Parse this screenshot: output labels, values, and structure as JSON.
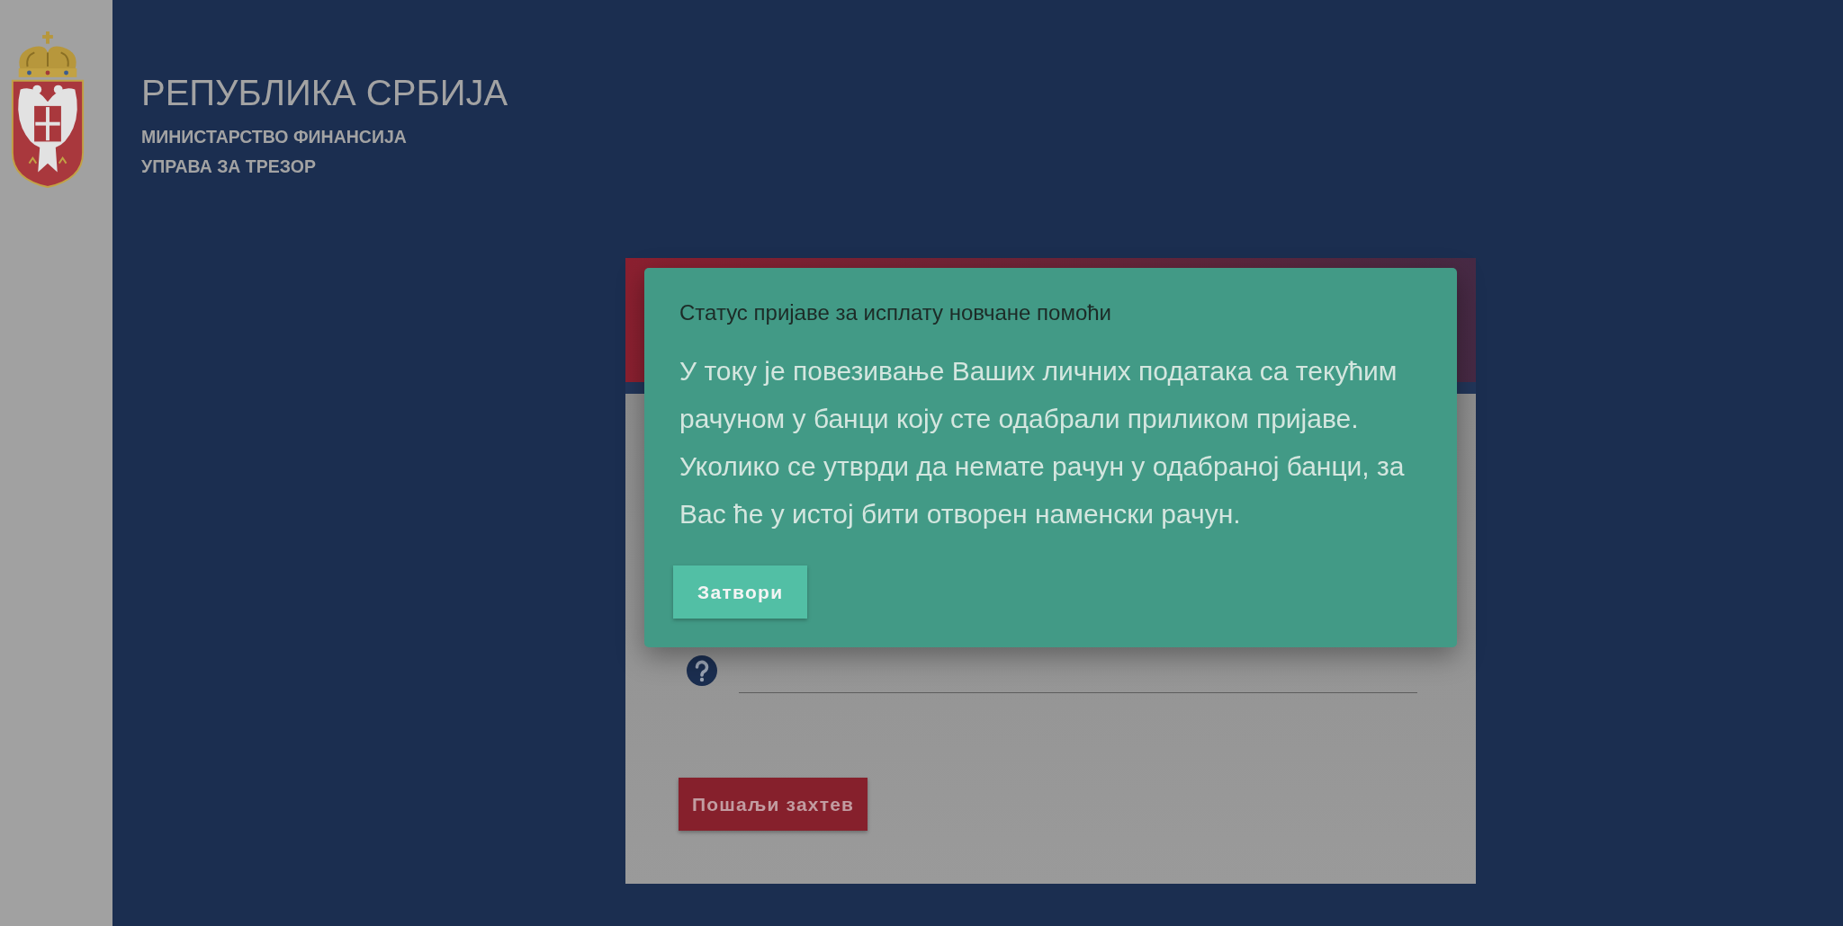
{
  "header": {
    "title": "РЕПУБЛИКА СРБИЈА",
    "subtitles": [
      "МИНИСТАРСТВО ФИНАНСИЈА",
      "УПРАВА ЗА ТРЕЗОР"
    ]
  },
  "form": {
    "submit": "Пошаљи захтев"
  },
  "dialog": {
    "title": "Статус пријаве за исплату новчане помоћи",
    "message": "У току је повезивање Ваших личних података са текућим рачуном у банци коју сте одабрали приликом пријаве. Уколико се утврди да немате рачун у одабраној банци, за Вас ће у истој бити отворен наменски рачун.",
    "buttons": [
      "Затвори"
    ]
  }
}
